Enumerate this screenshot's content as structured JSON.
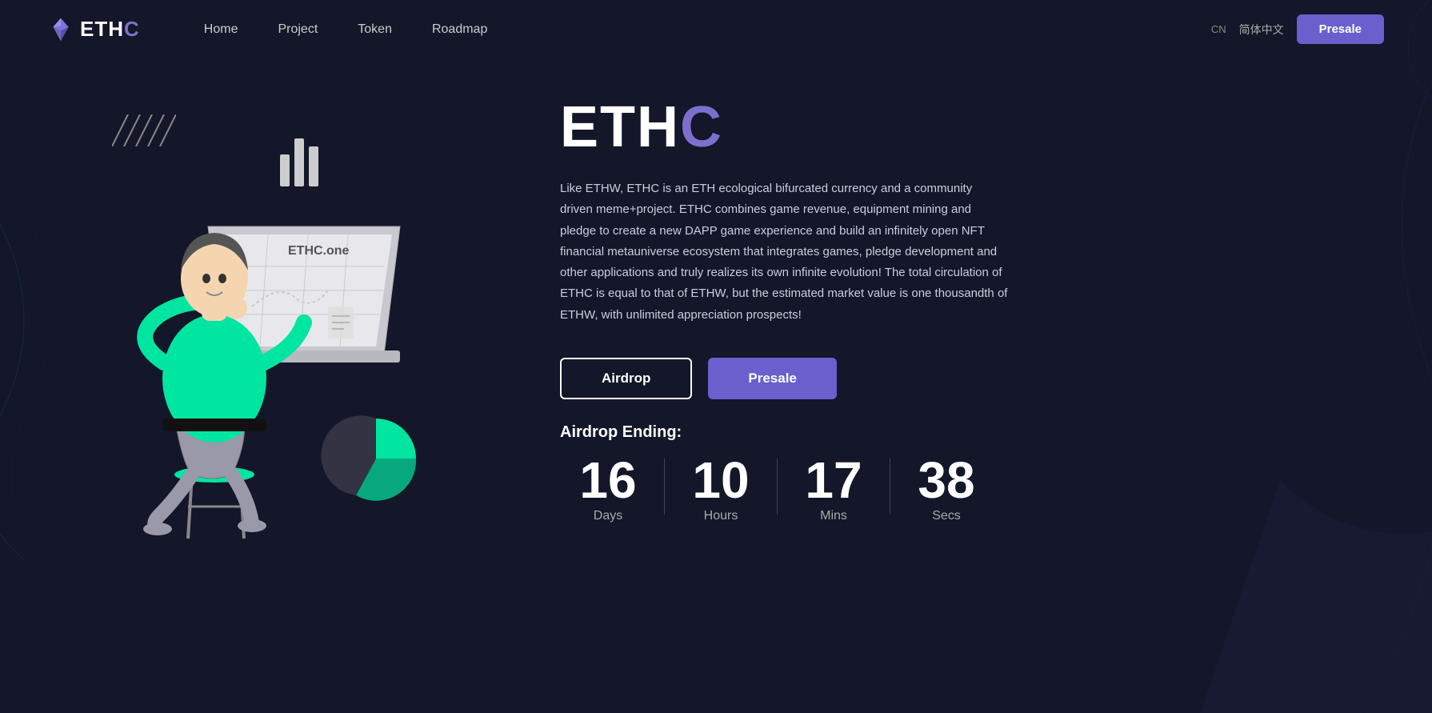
{
  "nav": {
    "logo_eth": "ETH",
    "logo_accent": "C",
    "links": [
      {
        "label": "Home",
        "id": "home"
      },
      {
        "label": "Project",
        "id": "project"
      },
      {
        "label": "Token",
        "id": "token"
      },
      {
        "label": "Roadmap",
        "id": "roadmap"
      }
    ],
    "lang_code": "CN",
    "lang_label": "简体中文",
    "presale_button": "Presale"
  },
  "hero": {
    "title_eth": "ETH",
    "title_accent": "C",
    "description": "Like ETHW, ETHC is an ETH ecological bifurcated currency and a community driven meme+project. ETHC combines game revenue, equipment mining and pledge to create a new DAPP game experience and build an infinitely open NFT financial metauniverse ecosystem that integrates games, pledge development and other applications and truly realizes its own infinite evolution! The total circulation of ETHC is equal to that of ETHW, but the estimated market value is one thousandth of ETHW, with unlimited appreciation prospects!",
    "airdrop_button": "Airdrop",
    "presale_button": "Presale",
    "countdown": {
      "label": "Airdrop Ending:",
      "days_value": "16",
      "days_text": "Days",
      "hours_value": "10",
      "hours_text": "Hours",
      "mins_value": "17",
      "mins_text": "Mins",
      "secs_value": "38",
      "secs_text": "Secs"
    }
  },
  "illustration": {
    "laptop_label": "ETHC.one"
  },
  "colors": {
    "bg": "#141629",
    "accent": "#7c6fcd",
    "green": "#00e5a0",
    "nav_presale_bg": "#6a5fcd"
  }
}
